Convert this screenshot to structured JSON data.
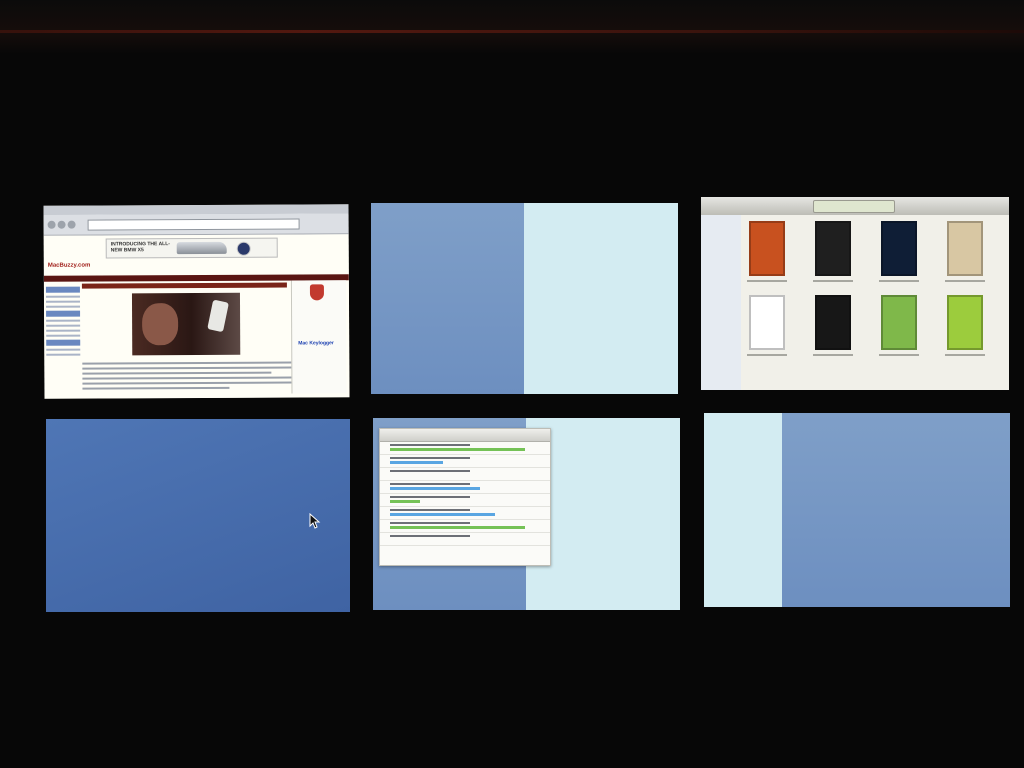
{
  "screen": {
    "description_colors": {
      "background": "#070707",
      "desktop_blue": "#4a6fb0",
      "light_panel": "#d3ecf2"
    }
  },
  "spaces": [
    {
      "id": 1,
      "content": "browser",
      "icon": "browser-window",
      "ad_text": "INTRODUCING THE ALL-NEW BMW X5",
      "site": "MacBuzzy.com",
      "sidebar_title": "Mac Keylogger"
    },
    {
      "id": 2,
      "content": "split-panel"
    },
    {
      "id": 3,
      "content": "itunes-movies",
      "posters": [
        "#c8511f",
        "#1f1f1f",
        "#0f1e36",
        "#d8c7a3",
        "#ffffff",
        "#171717",
        "#7fb84a",
        "#9ccc3d"
      ]
    },
    {
      "id": 4,
      "content": "empty-desktop",
      "icon": "cursor-arrow-icon"
    },
    {
      "id": 5,
      "content": "transfers-window",
      "progress": [
        0.9,
        0.35,
        0.0,
        0.6,
        0.2,
        0.7,
        0.9,
        0.0
      ]
    },
    {
      "id": 6,
      "content": "split-panel"
    }
  ]
}
